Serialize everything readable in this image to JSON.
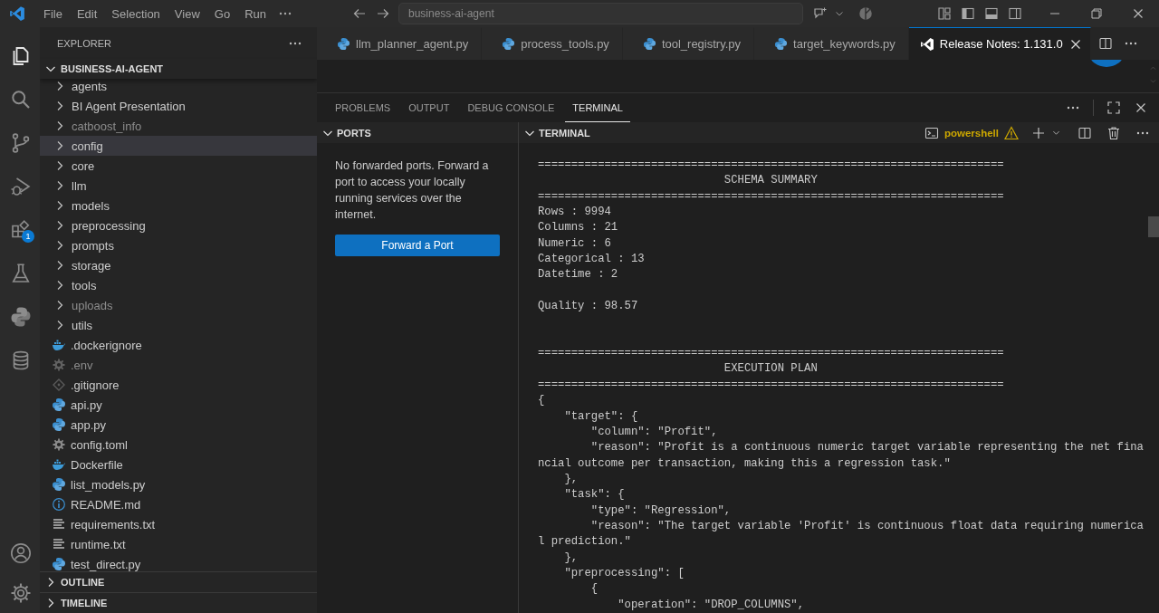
{
  "title_bar": {
    "menu": [
      "File",
      "Edit",
      "Selection",
      "View",
      "Go",
      "Run"
    ],
    "search": {
      "value": "business-ai-agent"
    }
  },
  "activity_bar": [
    {
      "kind": "explorer",
      "selected": true
    },
    {
      "kind": "search",
      "selected": false
    },
    {
      "kind": "source-control",
      "selected": false
    },
    {
      "kind": "run-debug",
      "selected": false
    },
    {
      "kind": "extensions",
      "selected": false,
      "badge": "1"
    },
    {
      "kind": "testing",
      "selected": false
    },
    {
      "kind": "python",
      "selected": false
    },
    {
      "kind": "database",
      "selected": false
    }
  ],
  "activity_bar_bottom": [
    {
      "kind": "account"
    },
    {
      "kind": "settings"
    }
  ],
  "sidebar": {
    "title": "EXPLORER",
    "root": {
      "label": "BUSINESS-AI-AGENT",
      "expanded": true
    },
    "items": [
      {
        "label": "agents",
        "kind": "folder",
        "expanded": false,
        "dimmed": false,
        "selected": false
      },
      {
        "label": "BI Agent Presentation",
        "kind": "folder",
        "expanded": false,
        "dimmed": false,
        "selected": false
      },
      {
        "label": "catboost_info",
        "kind": "folder",
        "expanded": false,
        "dimmed": true,
        "selected": false
      },
      {
        "label": "config",
        "kind": "folder",
        "expanded": false,
        "dimmed": false,
        "selected": true
      },
      {
        "label": "core",
        "kind": "folder",
        "expanded": false,
        "dimmed": false,
        "selected": false
      },
      {
        "label": "llm",
        "kind": "folder",
        "expanded": false,
        "dimmed": false,
        "selected": false
      },
      {
        "label": "models",
        "kind": "folder",
        "expanded": false,
        "dimmed": false,
        "selected": false
      },
      {
        "label": "preprocessing",
        "kind": "folder",
        "expanded": false,
        "dimmed": false,
        "selected": false
      },
      {
        "label": "prompts",
        "kind": "folder",
        "expanded": false,
        "dimmed": false,
        "selected": false
      },
      {
        "label": "storage",
        "kind": "folder",
        "expanded": false,
        "dimmed": false,
        "selected": false
      },
      {
        "label": "tools",
        "kind": "folder",
        "expanded": false,
        "dimmed": false,
        "selected": false
      },
      {
        "label": "uploads",
        "kind": "folder",
        "expanded": false,
        "dimmed": true,
        "selected": false
      },
      {
        "label": "utils",
        "kind": "folder",
        "expanded": false,
        "dimmed": false,
        "selected": false
      },
      {
        "label": ".dockerignore",
        "kind": "docker-file",
        "dimmed": false,
        "selected": false
      },
      {
        "label": ".env",
        "kind": "settings-file",
        "dimmed": true,
        "selected": false
      },
      {
        "label": ".gitignore",
        "kind": "git-file",
        "dimmed": false,
        "selected": false
      },
      {
        "label": "api.py",
        "kind": "python-file",
        "dimmed": false,
        "selected": false
      },
      {
        "label": "app.py",
        "kind": "python-file",
        "dimmed": false,
        "selected": false
      },
      {
        "label": "config.toml",
        "kind": "settings-file",
        "dimmed": false,
        "selected": false
      },
      {
        "label": "Dockerfile",
        "kind": "docker-file",
        "dimmed": false,
        "selected": false
      },
      {
        "label": "list_models.py",
        "kind": "python-file",
        "dimmed": false,
        "selected": false
      },
      {
        "label": "README.md",
        "kind": "info-file",
        "dimmed": false,
        "selected": false
      },
      {
        "label": "requirements.txt",
        "kind": "text-file",
        "dimmed": false,
        "selected": false
      },
      {
        "label": "runtime.txt",
        "kind": "text-file",
        "dimmed": false,
        "selected": false
      },
      {
        "label": "test_direct.py",
        "kind": "python-file",
        "dimmed": false,
        "selected": false
      }
    ],
    "sections": [
      {
        "label": "OUTLINE",
        "expanded": false
      },
      {
        "label": "TIMELINE",
        "expanded": false
      }
    ]
  },
  "editor_tabs": [
    {
      "label": "llm_planner_agent.py",
      "kind": "python",
      "selected": false
    },
    {
      "label": "process_tools.py",
      "kind": "python",
      "selected": false
    },
    {
      "label": "tool_registry.py",
      "kind": "python",
      "selected": false
    },
    {
      "label": "target_keywords.py",
      "kind": "python",
      "selected": false
    },
    {
      "label": "Release Notes: 1.131.0",
      "kind": "release-notes",
      "selected": true
    }
  ],
  "panel": {
    "tabs": [
      {
        "label": "PROBLEMS",
        "selected": false
      },
      {
        "label": "OUTPUT",
        "selected": false
      },
      {
        "label": "DEBUG CONSOLE",
        "selected": false
      },
      {
        "label": "TERMINAL",
        "selected": true
      }
    ],
    "ports": {
      "title": "PORTS",
      "expanded": true,
      "message": "No forwarded ports. Forward a port to access your locally running services over the internet.",
      "button": "Forward a Port"
    },
    "terminal": {
      "title": "TERMINAL",
      "expanded": true,
      "shell": "powershell",
      "lines": [
        {
          "kind": "text",
          "text": "======================================================================"
        },
        {
          "kind": "text",
          "text": "                            SCHEMA SUMMARY"
        },
        {
          "kind": "text",
          "text": "======================================================================"
        },
        {
          "kind": "text",
          "text": "Rows : 9994"
        },
        {
          "kind": "text",
          "text": "Columns : 21"
        },
        {
          "kind": "text",
          "text": "Numeric : 6"
        },
        {
          "kind": "text",
          "text": "Categorical : 13"
        },
        {
          "kind": "text",
          "text": "Datetime : 2"
        },
        {
          "kind": "blank"
        },
        {
          "kind": "text",
          "text": "Quality : 98.57"
        },
        {
          "kind": "blank"
        },
        {
          "kind": "blank"
        },
        {
          "kind": "text",
          "text": "======================================================================"
        },
        {
          "kind": "text",
          "text": "                            EXECUTION PLAN"
        },
        {
          "kind": "text",
          "text": "======================================================================"
        },
        {
          "kind": "text",
          "text": "{"
        },
        {
          "kind": "text",
          "text": "    \"target\": {"
        },
        {
          "kind": "text",
          "text": "        \"column\": \"Profit\","
        },
        {
          "kind": "text",
          "text": "        \"reason\": \"Profit is a continuous numeric target variable representing the net fina"
        },
        {
          "kind": "text",
          "text": "ncial outcome per transaction, making this a regression task.\""
        },
        {
          "kind": "text",
          "text": "    },"
        },
        {
          "kind": "text",
          "text": "    \"task\": {"
        },
        {
          "kind": "text",
          "text": "        \"type\": \"Regression\","
        },
        {
          "kind": "text",
          "text": "        \"reason\": \"The target variable 'Profit' is continuous float data requiring numerica"
        },
        {
          "kind": "text",
          "text": "l prediction.\""
        },
        {
          "kind": "text",
          "text": "    },"
        },
        {
          "kind": "text",
          "text": "    \"preprocessing\": ["
        },
        {
          "kind": "text",
          "text": "        {"
        },
        {
          "kind": "text",
          "text": "            \"operation\": \"DROP_COLUMNS\","
        }
      ]
    }
  }
}
